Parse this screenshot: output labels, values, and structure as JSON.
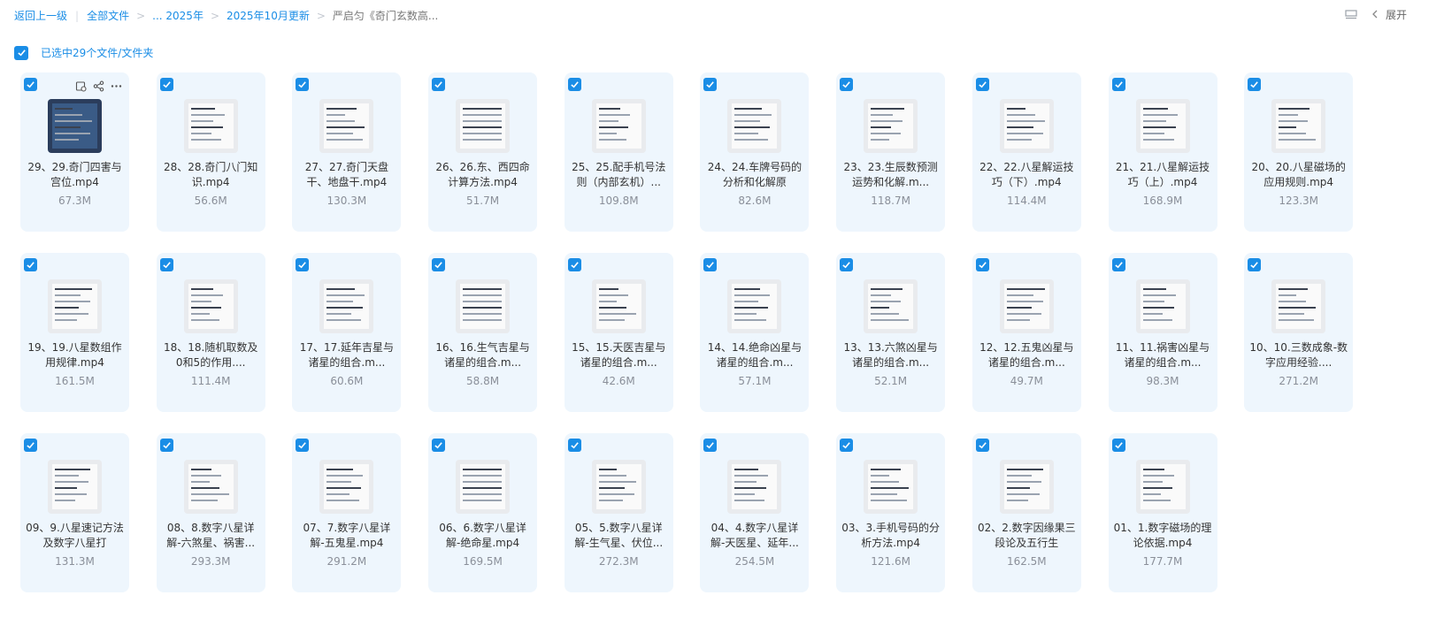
{
  "breadcrumb": {
    "back": "返回上一级",
    "all_files": "全部文件",
    "ellipsis_year": "... 2025年",
    "month": "2025年10月更新",
    "current": "严启匀《奇门玄数高..."
  },
  "toolbar": {
    "expand_label": "展开"
  },
  "selection": {
    "text": "已选中29个文件/文件夹"
  },
  "colors": {
    "accent": "#1a8de6",
    "card_bg": "#eef6fd"
  },
  "files": [
    {
      "name": "29、29.奇门四害与宫位.mp4",
      "size": "67.3M"
    },
    {
      "name": "28、28.奇门八门知识.mp4",
      "size": "56.6M"
    },
    {
      "name": "27、27.奇门天盘干、地盘干.mp4",
      "size": "130.3M"
    },
    {
      "name": "26、26.东、西四命计算方法.mp4",
      "size": "51.7M"
    },
    {
      "name": "25、25.配手机号法则（内部玄机）...",
      "size": "109.8M"
    },
    {
      "name": "24、24.车牌号码的分析和化解原",
      "size": "82.6M"
    },
    {
      "name": "23、23.生辰数预测运势和化解.m...",
      "size": "118.7M"
    },
    {
      "name": "22、22.八星解运技巧（下）.mp4",
      "size": "114.4M"
    },
    {
      "name": "21、21.八星解运技巧（上）.mp4",
      "size": "168.9M"
    },
    {
      "name": "20、20.八星磁场的应用规则.mp4",
      "size": "123.3M"
    },
    {
      "name": "19、19.八星数组作用规律.mp4",
      "size": "161.5M"
    },
    {
      "name": "18、18.随机取数及0和5的作用....",
      "size": "111.4M"
    },
    {
      "name": "17、17.延年吉星与诸星的组合.m...",
      "size": "60.6M"
    },
    {
      "name": "16、16.生气吉星与诸星的组合.m...",
      "size": "58.8M"
    },
    {
      "name": "15、15.天医吉星与诸星的组合.m...",
      "size": "42.6M"
    },
    {
      "name": "14、14.绝命凶星与诸星的组合.m...",
      "size": "57.1M"
    },
    {
      "name": "13、13.六煞凶星与诸星的组合.m...",
      "size": "52.1M"
    },
    {
      "name": "12、12.五鬼凶星与诸星的组合.m...",
      "size": "49.7M"
    },
    {
      "name": "11、11.祸害凶星与诸星的组合.m...",
      "size": "98.3M"
    },
    {
      "name": "10、10.三数成象-数字应用经验....",
      "size": "271.2M"
    },
    {
      "name": "09、9.八星速记方法及数字八星打",
      "size": "131.3M"
    },
    {
      "name": "08、8.数字八星详解-六煞星、祸害...",
      "size": "293.3M"
    },
    {
      "name": "07、7.数字八星详解-五鬼星.mp4",
      "size": "291.2M"
    },
    {
      "name": "06、6.数字八星详解-绝命星.mp4",
      "size": "169.5M"
    },
    {
      "name": "05、5.数字八星详解-生气星、伏位...",
      "size": "272.3M"
    },
    {
      "name": "04、4.数字八星详解-天医星、延年...",
      "size": "254.5M"
    },
    {
      "name": "03、3.手机号码的分析方法.mp4",
      "size": "121.6M"
    },
    {
      "name": "02、2.数字因缘果三段论及五行生",
      "size": "162.5M"
    },
    {
      "name": "01、1.数字磁场的理论依据.mp4",
      "size": "177.7M"
    }
  ]
}
